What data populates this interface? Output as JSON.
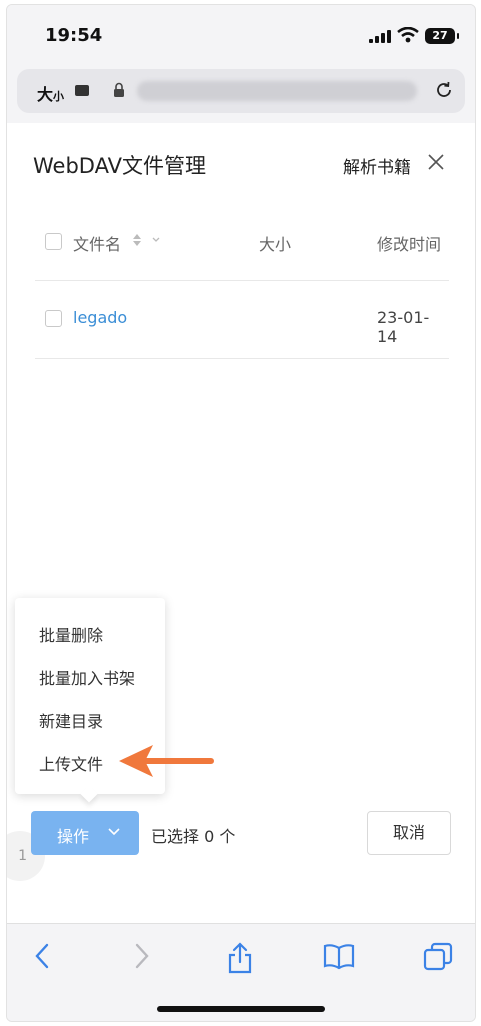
{
  "status_bar": {
    "time": "19:54",
    "battery": "27"
  },
  "url_bar": {
    "text_size_label": "大",
    "text_size_small": "小"
  },
  "panel": {
    "title": "WebDAV文件管理",
    "parse_books_label": "解析书籍"
  },
  "table": {
    "columns": [
      "文件名",
      "大小",
      "修改时间"
    ],
    "rows": [
      {
        "name": "legado",
        "size": "",
        "modified": "23-01-14"
      }
    ]
  },
  "menu": {
    "items": [
      "批量删除",
      "批量加入书架",
      "新建目录",
      "上传文件"
    ]
  },
  "actions": {
    "action_label": "操作",
    "selected_label": "已选择 0 个",
    "cancel_label": "取消"
  },
  "page_indicator": "1",
  "colors": {
    "accent": "#79b3f0",
    "link": "#3b8ed6",
    "annotation_arrow": "#f0783c"
  },
  "icons": [
    "lock-icon",
    "reload-icon",
    "close-icon",
    "sort-icon",
    "chevron-down-icon",
    "back-icon",
    "forward-icon",
    "share-icon",
    "bookmarks-icon",
    "tabs-icon"
  ]
}
